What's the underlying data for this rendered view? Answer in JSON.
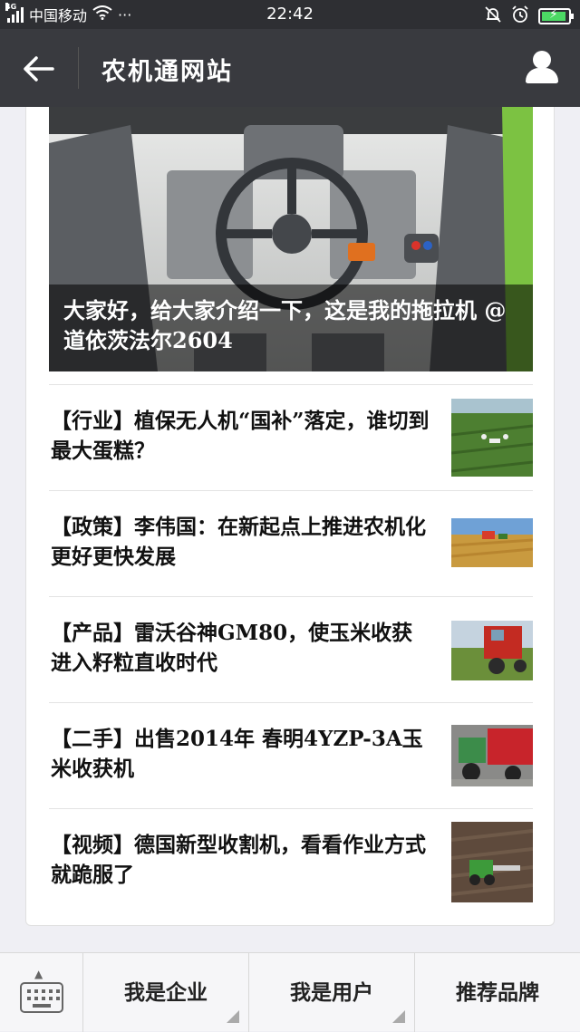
{
  "status": {
    "network": "4G",
    "carrier": "中国移动",
    "dots": "···",
    "time": "22:42"
  },
  "header": {
    "title": "农机通网站",
    "back_icon": "arrow-left-icon",
    "user_icon": "user-icon"
  },
  "hero": {
    "caption": "大家好，给大家介绍一下，这是我的拖拉机 @道依茨法尔2604"
  },
  "articles": [
    {
      "title": "【行业】植保无人机“国补”落定，谁切到最大蛋糕？"
    },
    {
      "title": "【政策】李伟国：在新起点上推进农机化更好更快发展"
    },
    {
      "title": "【产品】雷沃谷神GM80，使玉米收获进入籽粒直收时代"
    },
    {
      "title": "【二手】出售2014年 春明4YZP-3A玉米收获机"
    },
    {
      "title": "【视频】德国新型收割机，看看作业方式就跪服了"
    }
  ],
  "menu": {
    "keyboard_icon": "keyboard-icon",
    "items": [
      "我是企业",
      "我是用户",
      "推荐品牌"
    ]
  },
  "colors": {
    "status_bg": "#2e2f33",
    "titlebar_bg": "#393a3f",
    "page_bg": "#efeff4",
    "battery": "#4cd964"
  }
}
